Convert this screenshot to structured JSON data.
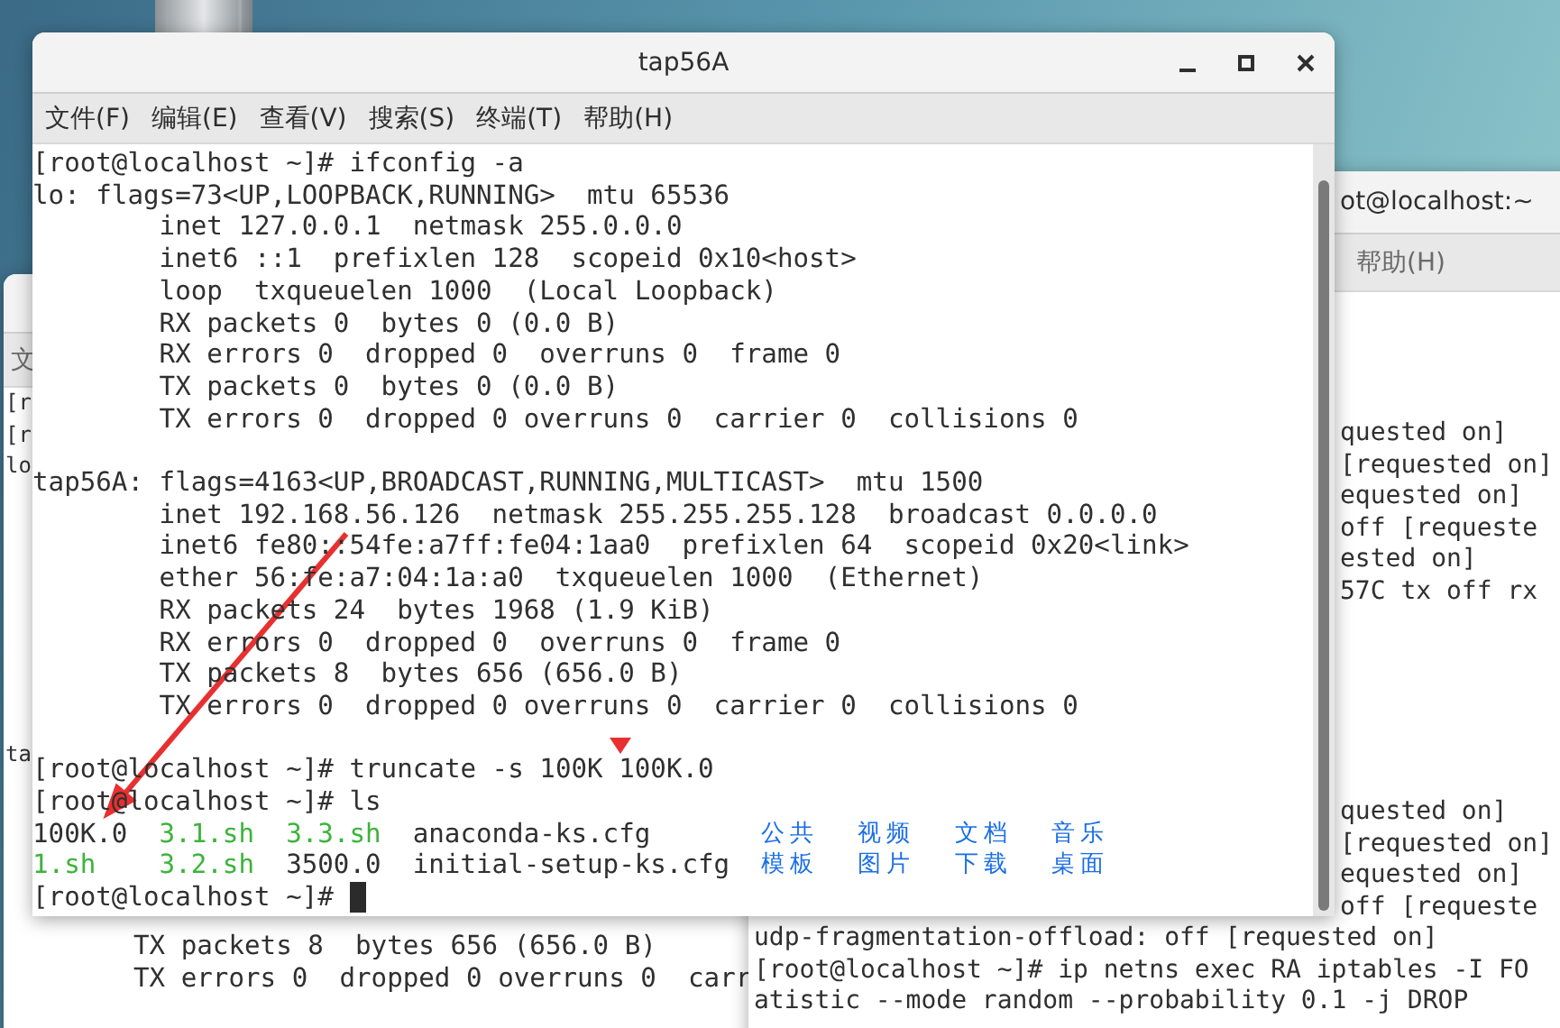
{
  "back_window_left": {
    "menu": [
      "文"
    ],
    "strip_lines": [
      "[r",
      "[r",
      "lo"
    ],
    "strip_lines_2": [
      "ta"
    ],
    "bottom_lines": [
      "TX packets 8  bytes 656 (656.0 B)",
      "TX errors 0  dropped 0 overruns 0  carr"
    ]
  },
  "back_window_right": {
    "title": "ot@localhost:~",
    "menu": [
      "帮助(H)"
    ],
    "upper_lines": [
      "quested on]",
      "[requested on]",
      "equested on]",
      "off [requeste",
      "ested on]",
      "57C tx off rx"
    ],
    "middle_lines": [
      "quested on]",
      "[requested on]",
      "equested on]",
      "off [requeste"
    ],
    "lower_lines": [
      "udp-fragmentation-offload: off [requested on]",
      "[root@localhost ~]# ip netns exec RA iptables -I FO",
      "atistic --mode random --probability 0.1 -j DROP"
    ]
  },
  "terminal": {
    "title": "tap56A",
    "menu": [
      "文件(F)",
      "编辑(E)",
      "查看(V)",
      "搜索(S)",
      "终端(T)",
      "帮助(H)"
    ],
    "lines": [
      {
        "kind": "prompt",
        "text": "[root@localhost ~]# ifconfig -a"
      },
      {
        "kind": "header",
        "text": "lo: flags=73<UP,LOOPBACK,RUNNING>  mtu 65536"
      },
      {
        "kind": "detail",
        "text": "inet 127.0.0.1  netmask 255.0.0.0"
      },
      {
        "kind": "detail",
        "text": "inet6 ::1  prefixlen 128  scopeid 0x10<host>"
      },
      {
        "kind": "detail",
        "text": "loop  txqueuelen 1000  (Local Loopback)"
      },
      {
        "kind": "detail",
        "text": "RX packets 0  bytes 0 (0.0 B)"
      },
      {
        "kind": "detail",
        "text": "RX errors 0  dropped 0  overruns 0  frame 0"
      },
      {
        "kind": "detail",
        "text": "TX packets 0  bytes 0 (0.0 B)"
      },
      {
        "kind": "detail",
        "text": "TX errors 0  dropped 0 overruns 0  carrier 0  collisions 0"
      },
      {
        "kind": "blank"
      },
      {
        "kind": "header",
        "text": "tap56A: flags=4163<UP,BROADCAST,RUNNING,MULTICAST>  mtu 1500"
      },
      {
        "kind": "detail",
        "text": "inet 192.168.56.126  netmask 255.255.255.128  broadcast 0.0.0.0"
      },
      {
        "kind": "detail",
        "text": "inet6 fe80::54fe:a7ff:fe04:1aa0  prefixlen 64  scopeid 0x20<link>"
      },
      {
        "kind": "detail",
        "text": "ether 56:fe:a7:04:1a:a0  txqueuelen 1000  (Ethernet)"
      },
      {
        "kind": "detail",
        "text": "RX packets 24  bytes 1968 (1.9 KiB)"
      },
      {
        "kind": "detail",
        "text": "RX errors 0  dropped 0  overruns 0  frame 0"
      },
      {
        "kind": "detail",
        "text": "TX packets 8  bytes 656 (656.0 B)"
      },
      {
        "kind": "detail",
        "text": "TX errors 0  dropped 0 overruns 0  carrier 0  collisions 0"
      },
      {
        "kind": "blank"
      },
      {
        "kind": "prompt",
        "text": "[root@localhost ~]# truncate -s 100K 100K.0"
      },
      {
        "kind": "prompt",
        "text": "[root@localhost ~]# ls"
      },
      {
        "kind": "listing",
        "cells": [
          {
            "text": "100K.0",
            "color": "#303030"
          },
          {
            "text": "3.1.sh",
            "color": "#3cb43c"
          },
          {
            "text": "3.3.sh",
            "color": "#3cb43c"
          },
          {
            "text": "anaconda-ks.cfg",
            "color": "#303030"
          },
          {
            "text": "公共",
            "color": "#1a6ee6"
          },
          {
            "text": "视频",
            "color": "#1a6ee6"
          },
          {
            "text": "文档",
            "color": "#1a6ee6"
          },
          {
            "text": "音乐",
            "color": "#1a6ee6"
          }
        ]
      },
      {
        "kind": "listing",
        "cells": [
          {
            "text": "1.sh",
            "color": "#3cb43c"
          },
          {
            "text": "3.2.sh",
            "color": "#3cb43c"
          },
          {
            "text": "3500.0",
            "color": "#303030"
          },
          {
            "text": "initial-setup-ks.cfg",
            "color": "#303030"
          },
          {
            "text": "模板",
            "color": "#1a6ee6"
          },
          {
            "text": "图片",
            "color": "#1a6ee6"
          },
          {
            "text": "下载",
            "color": "#1a6ee6"
          },
          {
            "text": "桌面",
            "color": "#1a6ee6"
          }
        ]
      },
      {
        "kind": "prompt",
        "text": "[root@localhost ~]#",
        "cursor": true
      }
    ]
  }
}
